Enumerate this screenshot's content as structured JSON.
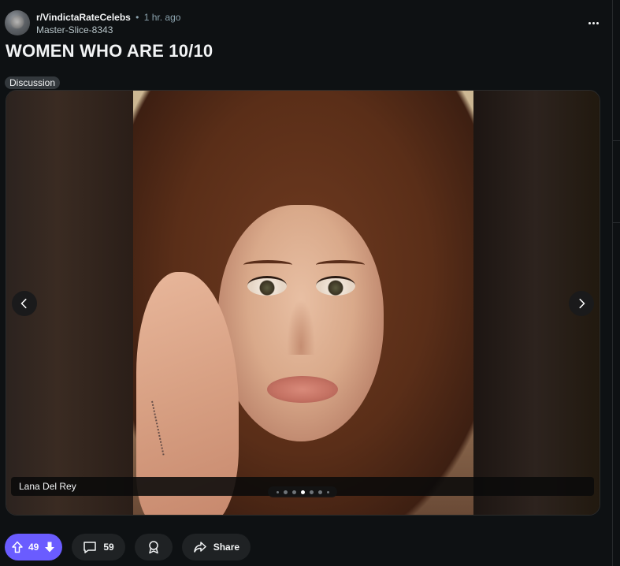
{
  "post": {
    "subreddit": "r/VindictaRateCelebs",
    "separator": "•",
    "time": "1 hr. ago",
    "author": "Master-Slice-8343",
    "title": "WOMEN WHO ARE 10/10",
    "flair": "Discussion",
    "overflow_icon": "more-horizontal-icon"
  },
  "gallery": {
    "caption": "Lana Del Rey",
    "total_slides": 7,
    "active_slide": 4,
    "prev_icon": "chevron-left-icon",
    "next_icon": "chevron-right-icon"
  },
  "actions": {
    "upvotes": "49",
    "comments": "59",
    "share_label": "Share",
    "vote_color": "#6a5cff"
  },
  "colors": {
    "background": "#0e1113",
    "pill": "#1f2224",
    "accent": "#6a5cff"
  }
}
